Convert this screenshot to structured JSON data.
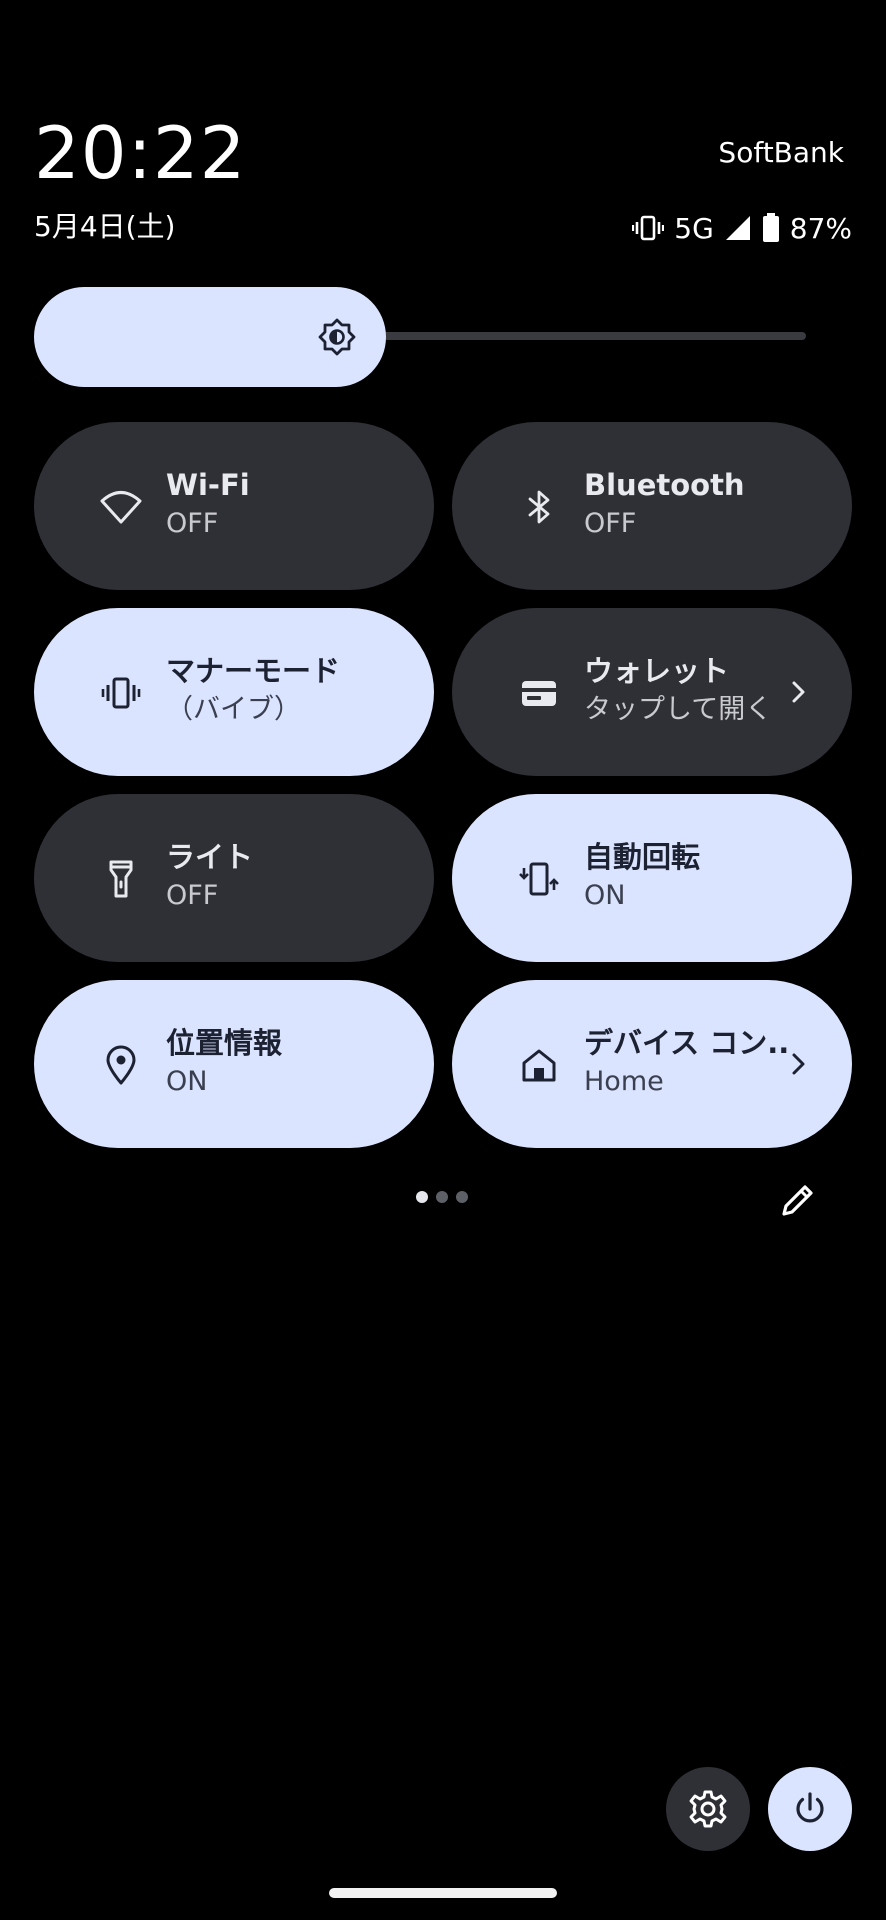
{
  "status": {
    "clock": "20:22",
    "carrier": "SoftBank",
    "date": "5月4日(土)",
    "network": "5G",
    "battery": "87%",
    "icons": [
      "vibrate-icon",
      "signal-icon",
      "battery-icon"
    ]
  },
  "brightness": {
    "level_percent": 40,
    "icon": "brightness-icon"
  },
  "tiles": [
    {
      "title": "Wi-Fi",
      "subtitle": "OFF",
      "state": "off",
      "icon": "wifi-icon"
    },
    {
      "title": "Bluetooth",
      "subtitle": "OFF",
      "state": "off",
      "icon": "bluetooth-icon"
    },
    {
      "title": "マナーモード",
      "subtitle": "（バイブ）",
      "state": "on",
      "icon": "vibrate-icon"
    },
    {
      "title": "ウォレット",
      "subtitle": "タップして開く",
      "state": "off",
      "icon": "wallet-icon",
      "chevron": true
    },
    {
      "title": "ライト",
      "subtitle": "OFF",
      "state": "off",
      "icon": "flashlight-icon"
    },
    {
      "title": "自動回転",
      "subtitle": "ON",
      "state": "on",
      "icon": "rotate-icon"
    },
    {
      "title": "位置情報",
      "subtitle": "ON",
      "state": "on",
      "icon": "location-icon"
    },
    {
      "title": "デバイス コン..",
      "subtitle": "Home",
      "state": "on",
      "icon": "home-icon",
      "chevron": true
    }
  ],
  "pager": {
    "pages": 3,
    "current": 1
  },
  "colors": {
    "background": "#000000",
    "tile_on": "#dbe4ff",
    "tile_off": "#2f3035",
    "text_on": "#1d2233",
    "text_off": "#e9eaef"
  }
}
